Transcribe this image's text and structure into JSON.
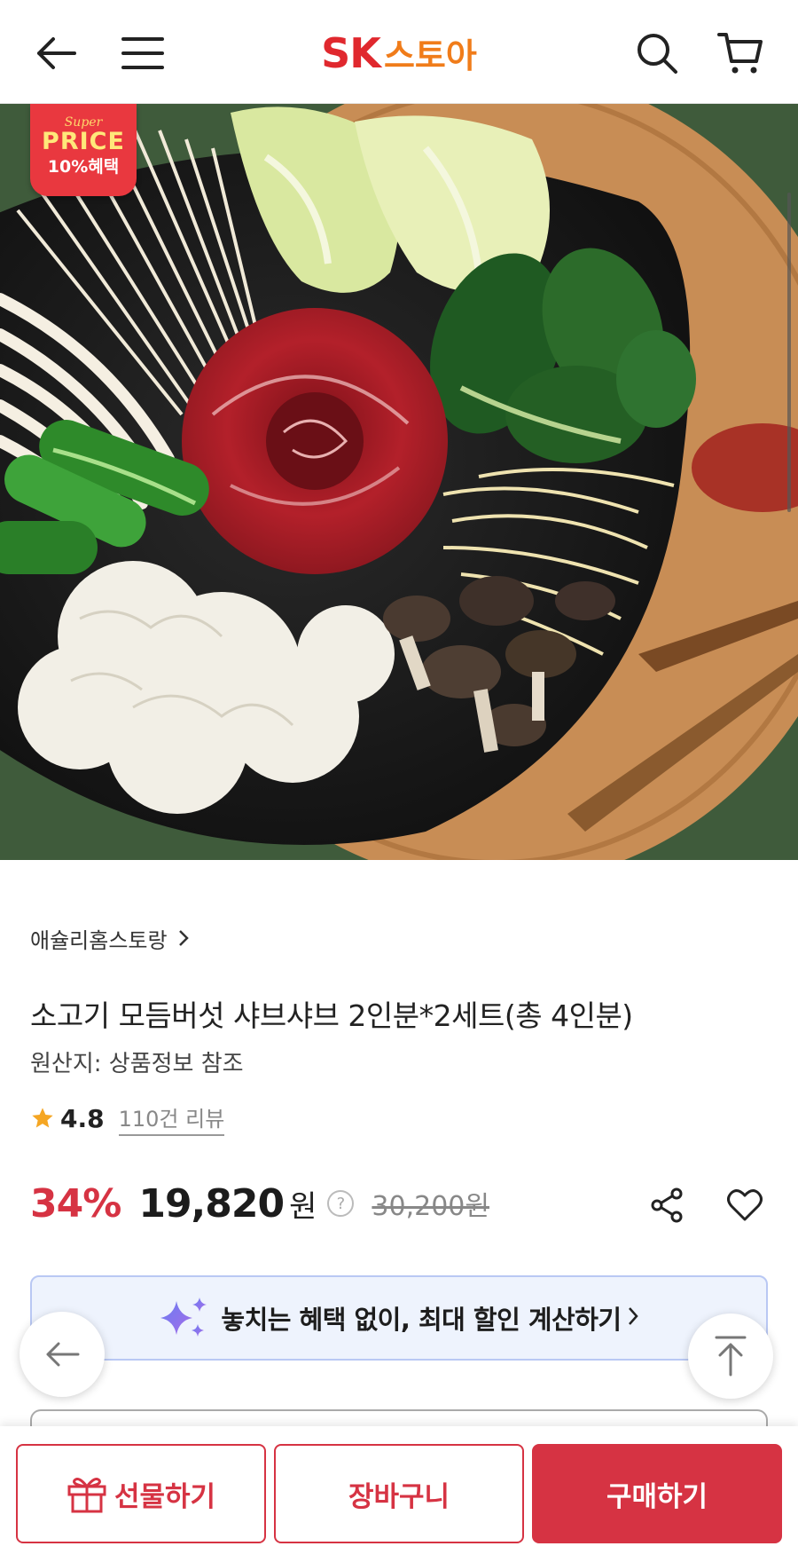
{
  "header": {
    "logo_sk": "SK",
    "logo_store": "스토아",
    "icons": [
      "back-arrow-icon",
      "menu-icon",
      "search-icon",
      "cart-icon"
    ]
  },
  "hero": {
    "badge_small": "Super",
    "badge_main": "PRICE",
    "badge_benefit": "10%혜택"
  },
  "product": {
    "seller": "애슐리홈스토랑",
    "title": "소고기 모듬버섯 샤브샤브 2인분*2세트(총 4인분)",
    "origin": "원산지: 상품정보 참조",
    "rating": "4.8",
    "reviews": "110건 리뷰",
    "discount": "34%",
    "price": "19,820",
    "currency": "원",
    "help_symbol": "?",
    "original_price": "30,200원"
  },
  "benefit_banner": {
    "text": "놓치는 혜택 없이, 최대 할인 계산하기"
  },
  "bottom_bar": {
    "gift_label": "선물하기",
    "cart_label": "장바구니",
    "buy_label": "구매하기"
  },
  "colors": {
    "brand_red": "#d63343",
    "logo_red": "#e0282e",
    "logo_orange": "#f07c1a",
    "banner_bg": "#eef3fd",
    "banner_border": "#b9c8f4",
    "star": "#f5a623"
  }
}
